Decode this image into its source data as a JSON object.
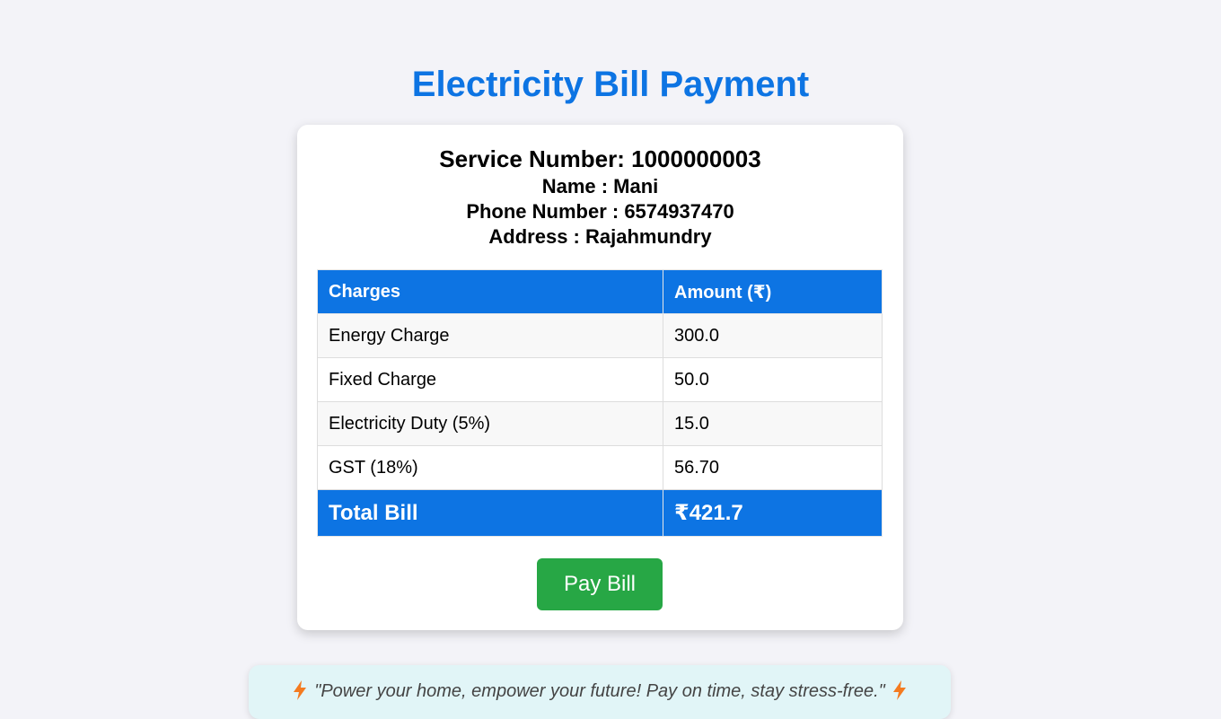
{
  "page": {
    "title": "Electricity Bill Payment"
  },
  "customer": {
    "service_number": "Service Number: 1000000003",
    "name": "Name : Mani",
    "phone": "Phone Number : 6574937470",
    "address": "Address : Rajahmundry"
  },
  "table": {
    "headers": [
      "Charges",
      "Amount (₹)"
    ],
    "rows": [
      {
        "charge": "Energy Charge",
        "amount": "300.0"
      },
      {
        "charge": "Fixed Charge",
        "amount": "50.0"
      },
      {
        "charge": "Electricity Duty (5%)",
        "amount": "15.0"
      },
      {
        "charge": "GST (18%)",
        "amount": "56.70"
      }
    ],
    "total": {
      "label": "Total Bill",
      "amount": "₹421.7"
    }
  },
  "actions": {
    "pay_label": "Pay Bill"
  },
  "quote": {
    "text": "\"Power your home, empower your future! Pay on time, stay stress-free.\"",
    "icon": "lightning-bolt-icon"
  },
  "colors": {
    "accent": "#0d74e3",
    "pay_button": "#27a745",
    "bolt": "#f47b20",
    "quote_bg": "#e1f5f7"
  }
}
